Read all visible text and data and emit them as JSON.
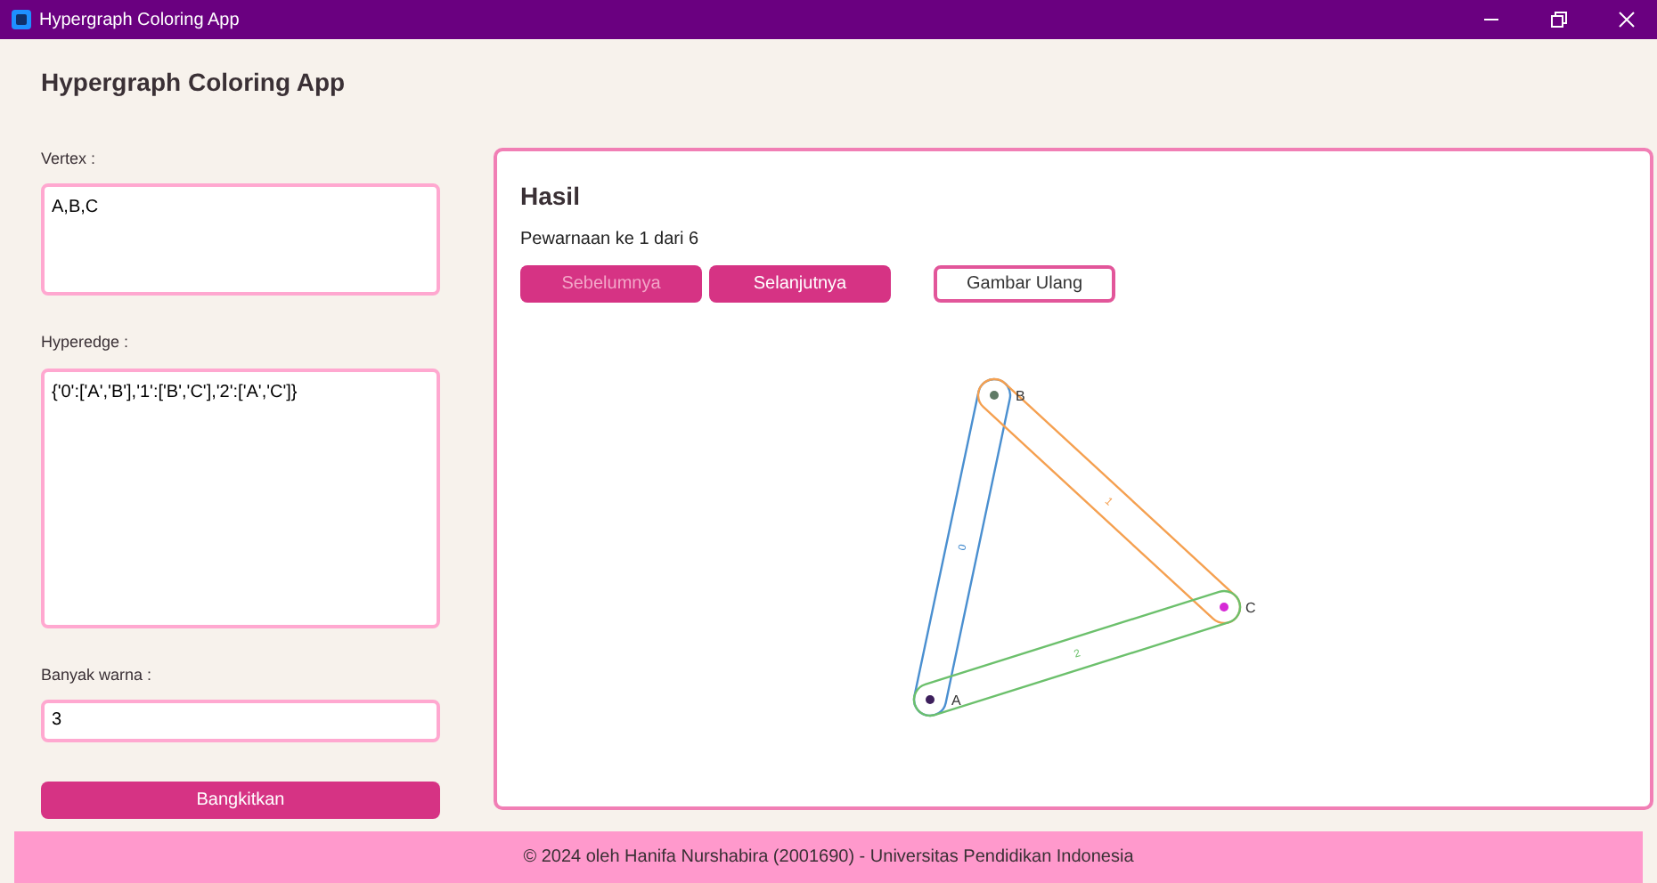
{
  "window": {
    "title": "Hypergraph Coloring App"
  },
  "header": {
    "title": "Hypergraph Coloring App"
  },
  "form": {
    "vertex": {
      "label": "Vertex :",
      "value": "A,B,C"
    },
    "hyperedge": {
      "label": "Hyperedge :",
      "value": "{'0':['A','B'],'1':['B','C'],'2':['A','C']}"
    },
    "colors": {
      "label": "Banyak warna :",
      "value": "3"
    },
    "generate_button": "Bangkitkan"
  },
  "result": {
    "title": "Hasil",
    "status": "Pewarnaan ke 1 dari 6",
    "buttons": [
      {
        "label": "Sebelumnya",
        "kind": "primary",
        "disabled": true
      },
      {
        "label": "Selanjutnya",
        "kind": "primary",
        "disabled": false
      },
      {
        "label": "Gambar Ulang",
        "kind": "outline",
        "disabled": false
      }
    ],
    "hypergraph": {
      "vertices": [
        {
          "label": "A",
          "color": "#3d1f5c"
        },
        {
          "label": "B",
          "color": "#5f7a66"
        },
        {
          "label": "C",
          "color": "#d629d6"
        }
      ],
      "edges": [
        {
          "label": "0",
          "color": "#4a8fd0"
        },
        {
          "label": "1",
          "color": "#f5a050"
        },
        {
          "label": "2",
          "color": "#6cc06c"
        }
      ]
    }
  },
  "footer": "© 2024 oleh Hanifa Nurshabira (2001690) - Universitas Pendidikan Indonesia"
}
